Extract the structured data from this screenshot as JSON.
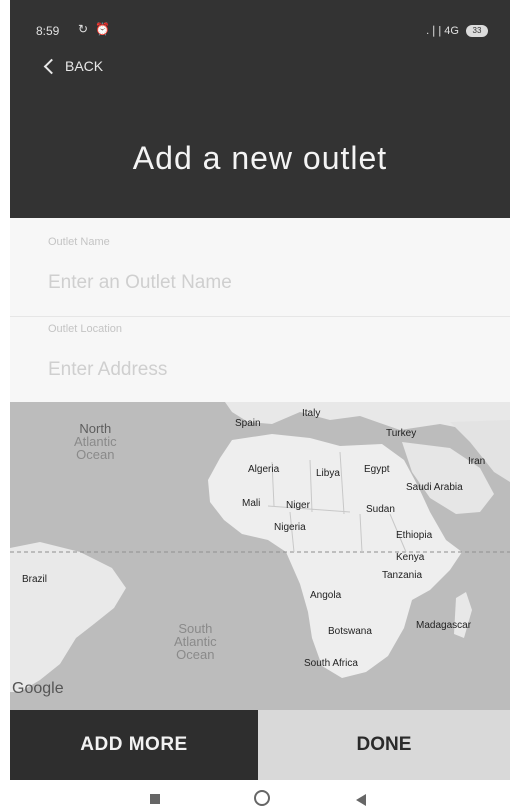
{
  "status_bar": {
    "time": "8:59",
    "left_icons": "↻ ⏰",
    "signal": ".❘| 4G",
    "battery": "33"
  },
  "header": {
    "back_label": "BACK",
    "title": "Add a new outlet"
  },
  "form": {
    "outlet_name_label": "Outlet Name",
    "outlet_name_placeholder": "Enter an Outlet Name",
    "outlet_name_value": "",
    "outlet_location_label": "Outlet Location",
    "outlet_location_placeholder": "Enter Address",
    "outlet_location_value": ""
  },
  "map": {
    "oceans": {
      "north_atlantic": [
        "North",
        "Atlantic",
        "Ocean"
      ],
      "south_atlantic": [
        "South",
        "Atlantic",
        "Ocean"
      ]
    },
    "countries": {
      "spain": "Spain",
      "italy": "Italy",
      "turkey": "Turkey",
      "iran": "Iran",
      "algeria": "Algeria",
      "libya": "Libya",
      "egypt": "Egypt",
      "saudi_arabia": "Saudi Arabia",
      "mali": "Mali",
      "niger": "Niger",
      "sudan": "Sudan",
      "nigeria": "Nigeria",
      "ethiopia": "Ethiopia",
      "kenya": "Kenya",
      "tanzania": "Tanzania",
      "brazil": "Brazil",
      "angola": "Angola",
      "botswana": "Botswana",
      "madagascar": "Madagascar",
      "south_africa": "South Africa"
    },
    "logo": "Google"
  },
  "buttons": {
    "add_more": "ADD MORE",
    "done": "DONE"
  },
  "colors": {
    "header_bg": "#333333",
    "add_more_bg": "#2e2e2e",
    "done_bg": "#d9d9d9"
  }
}
